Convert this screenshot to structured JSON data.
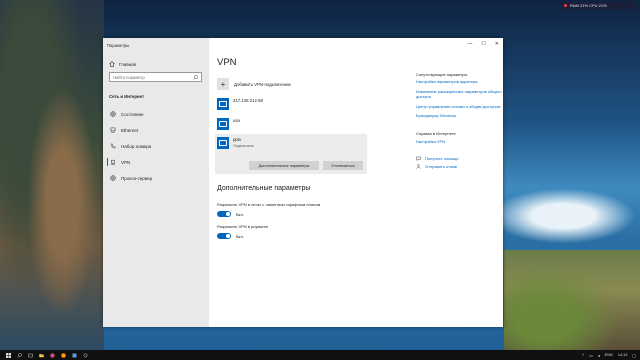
{
  "sysmon": {
    "text": "RAM 21%  CPU 21%"
  },
  "window": {
    "title": "Параметры",
    "controls": {
      "minimize": "—",
      "maximize": "☐",
      "close": "✕"
    }
  },
  "sidebar": {
    "home": "Главная",
    "search_placeholder": "Найти параметр",
    "section": "Сеть и Интернет",
    "items": [
      {
        "label": "Состояние",
        "icon": "globe-icon"
      },
      {
        "label": "Ethernet",
        "icon": "ethernet-icon"
      },
      {
        "label": "Набор номера",
        "icon": "phone-icon"
      },
      {
        "label": "VPN",
        "icon": "vpn-icon"
      },
      {
        "label": "Прокси-сервер",
        "icon": "globe-icon"
      }
    ]
  },
  "main": {
    "title": "VPN",
    "add_vpn": "Добавить VPN-подключение",
    "connections": [
      {
        "name": "217.138.212.58",
        "status": ""
      },
      {
        "name": "usa",
        "status": ""
      },
      {
        "name": "pptx",
        "status": "Подключено"
      }
    ],
    "buttons": {
      "advanced": "Дополнительные параметры",
      "disconnect": "Отключиться"
    },
    "advanced_title": "Дополнительные параметры",
    "options": [
      {
        "label": "Разрешить VPN в сетях с лимитным тарифным планом",
        "state": "Вкл."
      },
      {
        "label": "Разрешить VPN в роуминге",
        "state": "Вкл."
      }
    ]
  },
  "related": {
    "header": "Сопутствующие параметры",
    "links": [
      "Настройка параметров адаптера",
      "Изменение расширенных параметров общего доступа",
      "Центр управления сетями и общим доступом",
      "Брандмауэр Windows"
    ],
    "help_header": "Справка в Интернете",
    "help_link": "Настройка VPN",
    "get_help": "Получить помощь",
    "feedback": "Отправить отзыв"
  },
  "taskbar": {
    "lang": "ENG",
    "time": "14:13"
  },
  "colors": {
    "accent": "#0067c0",
    "sidebar_bg": "#e9e9e9"
  }
}
